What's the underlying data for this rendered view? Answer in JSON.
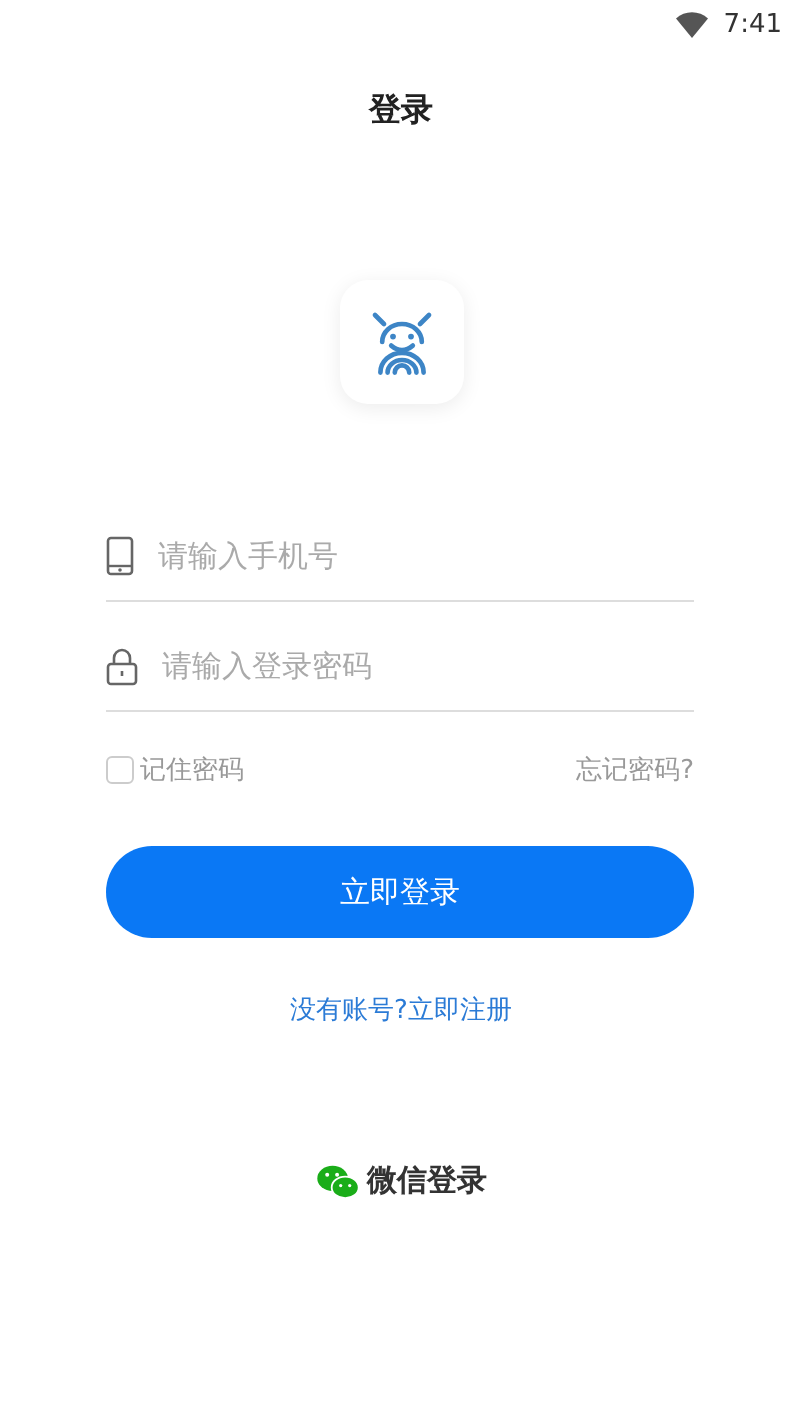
{
  "status_bar": {
    "time": "7:41"
  },
  "title": "登录",
  "fields": [
    {
      "kind": "phone",
      "placeholder": "请输入手机号"
    },
    {
      "kind": "password",
      "placeholder": "请输入登录密码"
    }
  ],
  "remember": {
    "label": "记住密码",
    "checked": false
  },
  "forgot_link": "忘记密码?",
  "login_button": "立即登录",
  "register_link": "没有账号?立即注册",
  "wechat_login": "微信登录"
}
